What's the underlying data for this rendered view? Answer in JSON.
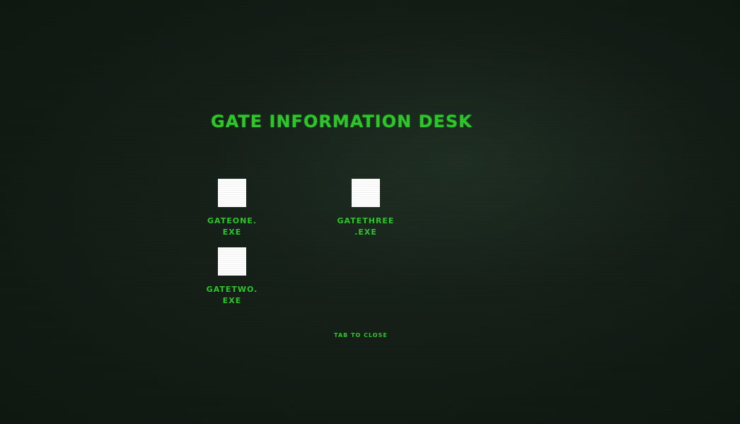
{
  "desk": {
    "title": "GATE INFORMATION DESK",
    "files": [
      {
        "label": "GATEONE.\nEXE"
      },
      {
        "label": "GATETHREE\n.EXE"
      },
      {
        "label": "GATETWO.\nEXE"
      }
    ],
    "close_hint": "TAB TO CLOSE"
  },
  "colors": {
    "text_green": "#2fc92c",
    "icon_white": "#ffffff",
    "background": "#0f1811"
  }
}
